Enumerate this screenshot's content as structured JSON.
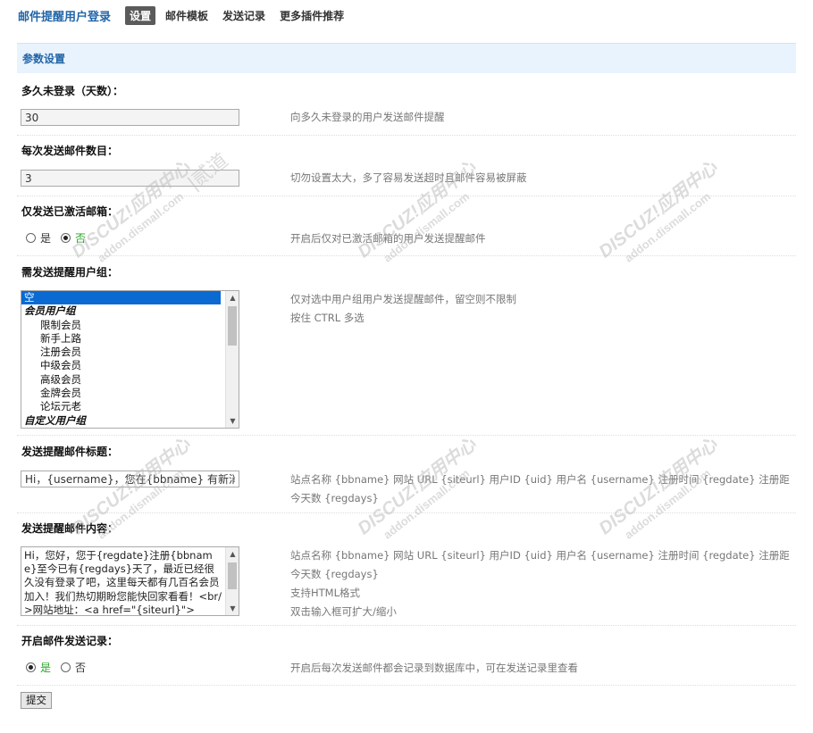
{
  "nav": {
    "title": "邮件提醒用户登录",
    "tabs": [
      {
        "label": "设置",
        "active": true
      },
      {
        "label": "邮件模板"
      },
      {
        "label": "发送记录"
      },
      {
        "label": "更多插件推荐"
      }
    ]
  },
  "section": {
    "title": "参数设置"
  },
  "fields": {
    "days": {
      "label": "多久未登录（天数）：",
      "value": "30",
      "hint": "向多久未登录的用户发送邮件提醒"
    },
    "count": {
      "label": "每次发送邮件数目：",
      "value": "3",
      "hint": "切勿设置太大，多了容易发送超时且邮件容易被屏蔽"
    },
    "verified": {
      "label": "仅发送已激活邮箱：",
      "yes": "是",
      "no": "否",
      "selected": "no",
      "hint": "开启后仅对已激活邮箱的用户发送提醒邮件"
    },
    "groups": {
      "label": "需发送提醒用户组：",
      "options": [
        {
          "text": "空",
          "type": "selected"
        },
        {
          "text": "会员用户组",
          "type": "group"
        },
        {
          "text": "限制会员",
          "type": "item"
        },
        {
          "text": "新手上路",
          "type": "item"
        },
        {
          "text": "注册会员",
          "type": "item"
        },
        {
          "text": "中级会员",
          "type": "item"
        },
        {
          "text": "高级会员",
          "type": "item"
        },
        {
          "text": "金牌会员",
          "type": "item"
        },
        {
          "text": "论坛元老",
          "type": "item"
        },
        {
          "text": "自定义用户组",
          "type": "group"
        }
      ],
      "hint1": "仅对选中用户组用户发送提醒邮件，留空则不限制",
      "hint2": "按住 CTRL 多选"
    },
    "subject": {
      "label": "发送提醒邮件标题：",
      "value": "Hi，{username}，您在{bbname} 有新消息",
      "hint1": "站点名称 {bbname} 网站 URL {siteurl} 用户ID {uid} 用户名 {username} 注册时间 {regdate} 注册距",
      "hint2": "今天数 {regdays}"
    },
    "content": {
      "label": "发送提醒邮件内容：",
      "value": "Hi，您好，您于{regdate}注册{bbname}至今已有{regdays}天了，最近已经很久没有登录了吧，这里每天都有几百名会员加入！我们热切期盼您能快回家看看！<br/>网站地址：<a href=\"{siteurl}\">",
      "hint1": "站点名称 {bbname} 网站 URL {siteurl} 用户ID {uid} 用户名 {username} 注册时间 {regdate} 注册距",
      "hint2": "今天数 {regdays}",
      "hint3": "支持HTML格式",
      "hint4": "双击输入框可扩大/缩小"
    },
    "log": {
      "label": "开启邮件发送记录：",
      "yes": "是",
      "no": "否",
      "selected": "yes",
      "hint": "开启后每次发送邮件都会记录到数据库中，可在发送记录里查看"
    }
  },
  "submit": {
    "label": "提交"
  },
  "watermark": {
    "brand": "DISCUZ!应用中心",
    "domain": "addon.dismall.com",
    "mark": "贰道"
  },
  "colors": {
    "accent": "#2366a8",
    "header_bg": "#e8f3fd",
    "selected_text": "#2aa52a",
    "list_selection": "#0a6ad2"
  }
}
